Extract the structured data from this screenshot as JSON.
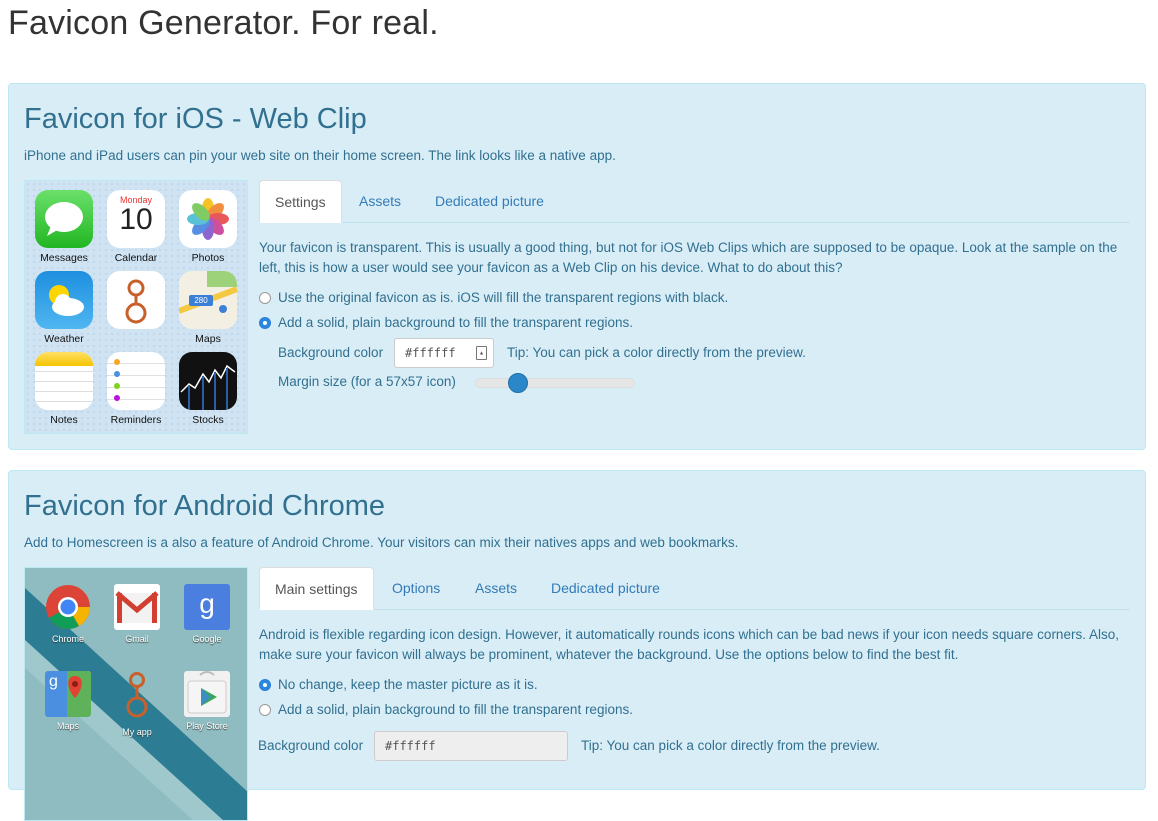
{
  "page": {
    "title": "Favicon Generator. For real."
  },
  "ios": {
    "title": "Favicon for iOS - Web Clip",
    "description": "iPhone and iPad users can pin your web site on their home screen. The link looks like a native app.",
    "apps": [
      {
        "label": "Messages",
        "icon": "messages-icon"
      },
      {
        "label": "Calendar",
        "icon": "calendar-icon",
        "day": "Monday",
        "date": "10"
      },
      {
        "label": "Photos",
        "icon": "photos-icon"
      },
      {
        "label": "Weather",
        "icon": "weather-icon"
      },
      {
        "label": "",
        "icon": "my-app-icon"
      },
      {
        "label": "Maps",
        "icon": "maps-icon",
        "badge": "280"
      },
      {
        "label": "Notes",
        "icon": "notes-icon"
      },
      {
        "label": "Reminders",
        "icon": "reminders-icon"
      },
      {
        "label": "Stocks",
        "icon": "stocks-icon"
      }
    ],
    "tabs": [
      "Settings",
      "Assets",
      "Dedicated picture"
    ],
    "active_tab": "Settings",
    "message": "Your favicon is transparent. This is usually a good thing, but not for iOS Web Clips which are supposed to be opaque. Look at the sample on the left, this is how a user would see your favicon as a Web Clip on his device. What to do about this?",
    "option_original": "Use the original favicon as is. iOS will fill the transparent regions with black.",
    "option_solid": "Add a solid, plain background to fill the transparent regions.",
    "selected_option": "solid",
    "background_color_label": "Background color",
    "background_color_value": "#ffffff",
    "tip": "Tip: You can pick a color directly from the preview.",
    "margin_label": "Margin size (for a 57x57 icon)",
    "margin_fraction": 0.27
  },
  "android": {
    "title": "Favicon for Android Chrome",
    "description": "Add to Homescreen is a also a feature of Android Chrome. Your visitors can mix their natives apps and web bookmarks.",
    "apps": [
      {
        "label": "Chrome",
        "icon": "chrome-icon"
      },
      {
        "label": "Gmail",
        "icon": "gmail-icon"
      },
      {
        "label": "Google",
        "icon": "google-icon",
        "glyph": "g"
      },
      {
        "label": "Maps",
        "icon": "maps-icon",
        "glyph": "g"
      },
      {
        "label": "My app",
        "icon": "my-app-icon"
      },
      {
        "label": "Play Store",
        "icon": "play-store-icon"
      }
    ],
    "tabs": [
      "Main settings",
      "Options",
      "Assets",
      "Dedicated picture"
    ],
    "active_tab": "Main settings",
    "message": "Android is flexible regarding icon design. However, it automatically rounds icons which can be bad news if your icon needs square corners. Also, make sure your favicon will always be prominent, whatever the background. Use the options below to find the best fit.",
    "option_no_change": "No change, keep the master picture as it is.",
    "option_solid": "Add a solid, plain background to fill the transparent regions.",
    "selected_option": "no_change",
    "background_color_label": "Background color",
    "background_color_value": "#ffffff",
    "tip": "Tip: You can pick a color directly from the preview."
  },
  "colors": {
    "panel_bg": "#d9edf7",
    "panel_text": "#31708f",
    "link": "#337ab7",
    "radio_checked": "#2a88e0",
    "slider_handle": "#2a88c8"
  }
}
